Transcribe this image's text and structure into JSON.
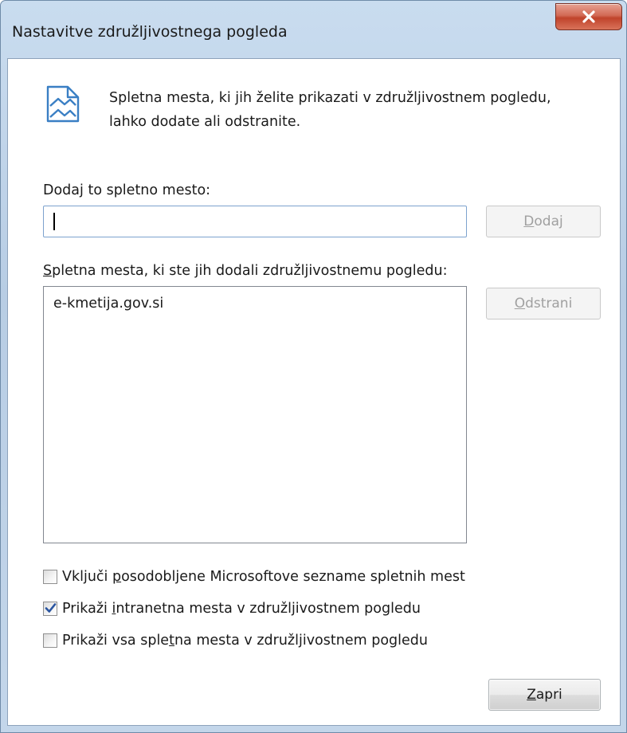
{
  "window": {
    "title": "Nastavitve združljivostnega pogleda",
    "close_icon": "close-x-icon"
  },
  "info": {
    "icon": "compatibility-view-icon",
    "text_line1": "Spletna mesta, ki jih želite prikazati v združljivostnem pogledu,",
    "text_line2": "lahko dodate ali odstranite."
  },
  "add_section": {
    "label_pre": "Doda",
    "label_accel": "j",
    "label_post": " to spletno mesto:",
    "input_value": "",
    "add_button_accel": "D",
    "add_button_rest": "odaj",
    "add_button_enabled": false
  },
  "list_section": {
    "label_accel": "S",
    "label_post": "pletna mesta, ki ste jih dodali združljivostnemu pogledu:",
    "items": [
      "e-kmetija.gov.si"
    ],
    "remove_button_accel": "O",
    "remove_button_rest": "dstrani",
    "remove_button_enabled": false
  },
  "options": [
    {
      "pre": "Vključi ",
      "accel": "p",
      "post": "osodobljene Microsoftove sezname spletnih mest",
      "checked": false
    },
    {
      "pre": "Prikaži ",
      "accel": "i",
      "post": "ntranetna mesta v združljivostnem pogledu",
      "checked": true
    },
    {
      "pre": "Prikaži vsa sple",
      "accel": "t",
      "post": "na mesta v združljivostnem pogledu",
      "checked": false
    }
  ],
  "footer": {
    "close_button_accel": "Z",
    "close_button_rest": "apri"
  },
  "colors": {
    "titlebar": "#c3d6ea",
    "close_button": "#c0432b",
    "icon_blue": "#3a7fc4",
    "check_blue": "#2a55a0"
  }
}
